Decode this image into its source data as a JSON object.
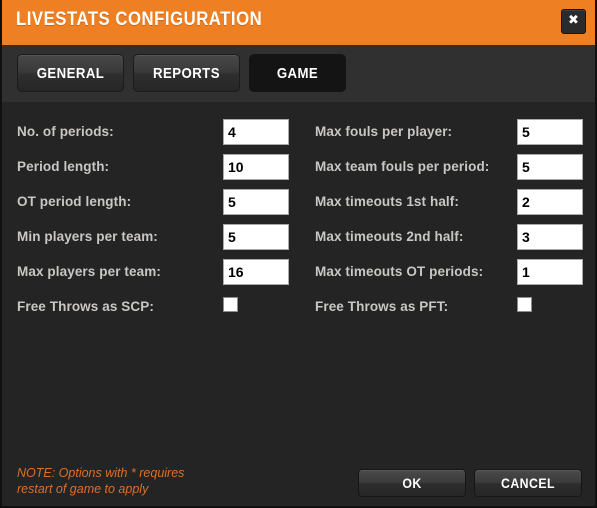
{
  "window": {
    "title": "LIVESTATS CONFIGURATION",
    "close_icon": "close-icon",
    "close_glyph": "✖",
    "accent_color": "#ee7f22",
    "background_color": "#242424",
    "tabbar_color": "#303030",
    "note_color": "#d9712a"
  },
  "tabs": [
    {
      "label": "GENERAL",
      "active": false
    },
    {
      "label": "REPORTS",
      "active": false
    },
    {
      "label": "GAME",
      "active": true
    }
  ],
  "form": {
    "left_column": [
      {
        "label": "No. of periods:",
        "type": "text",
        "value": "4"
      },
      {
        "label": "Period length:",
        "type": "text",
        "value": "10"
      },
      {
        "label": "OT period length:",
        "type": "text",
        "value": "5"
      },
      {
        "label": "Min players per team:",
        "type": "text",
        "value": "5"
      },
      {
        "label": "Max players per team:",
        "type": "text",
        "value": "16"
      },
      {
        "label": "Free Throws as SCP:",
        "type": "checkbox",
        "checked": false
      }
    ],
    "right_column": [
      {
        "label": "Max fouls per player:",
        "type": "text",
        "value": "5"
      },
      {
        "label": "Max team fouls per period:",
        "type": "text",
        "value": "5"
      },
      {
        "label": "Max timeouts 1st half:",
        "type": "text",
        "value": "2"
      },
      {
        "label": "Max timeouts  2nd half:",
        "type": "text",
        "value": "3"
      },
      {
        "label": "Max timeouts OT periods:",
        "type": "text",
        "value": "1"
      },
      {
        "label": "Free Throws as PFT:",
        "type": "checkbox",
        "checked": false
      }
    ]
  },
  "footer": {
    "note": "NOTE: Options with * requires\nrestart of game to apply",
    "ok_label": "OK",
    "cancel_label": "CANCEL"
  }
}
